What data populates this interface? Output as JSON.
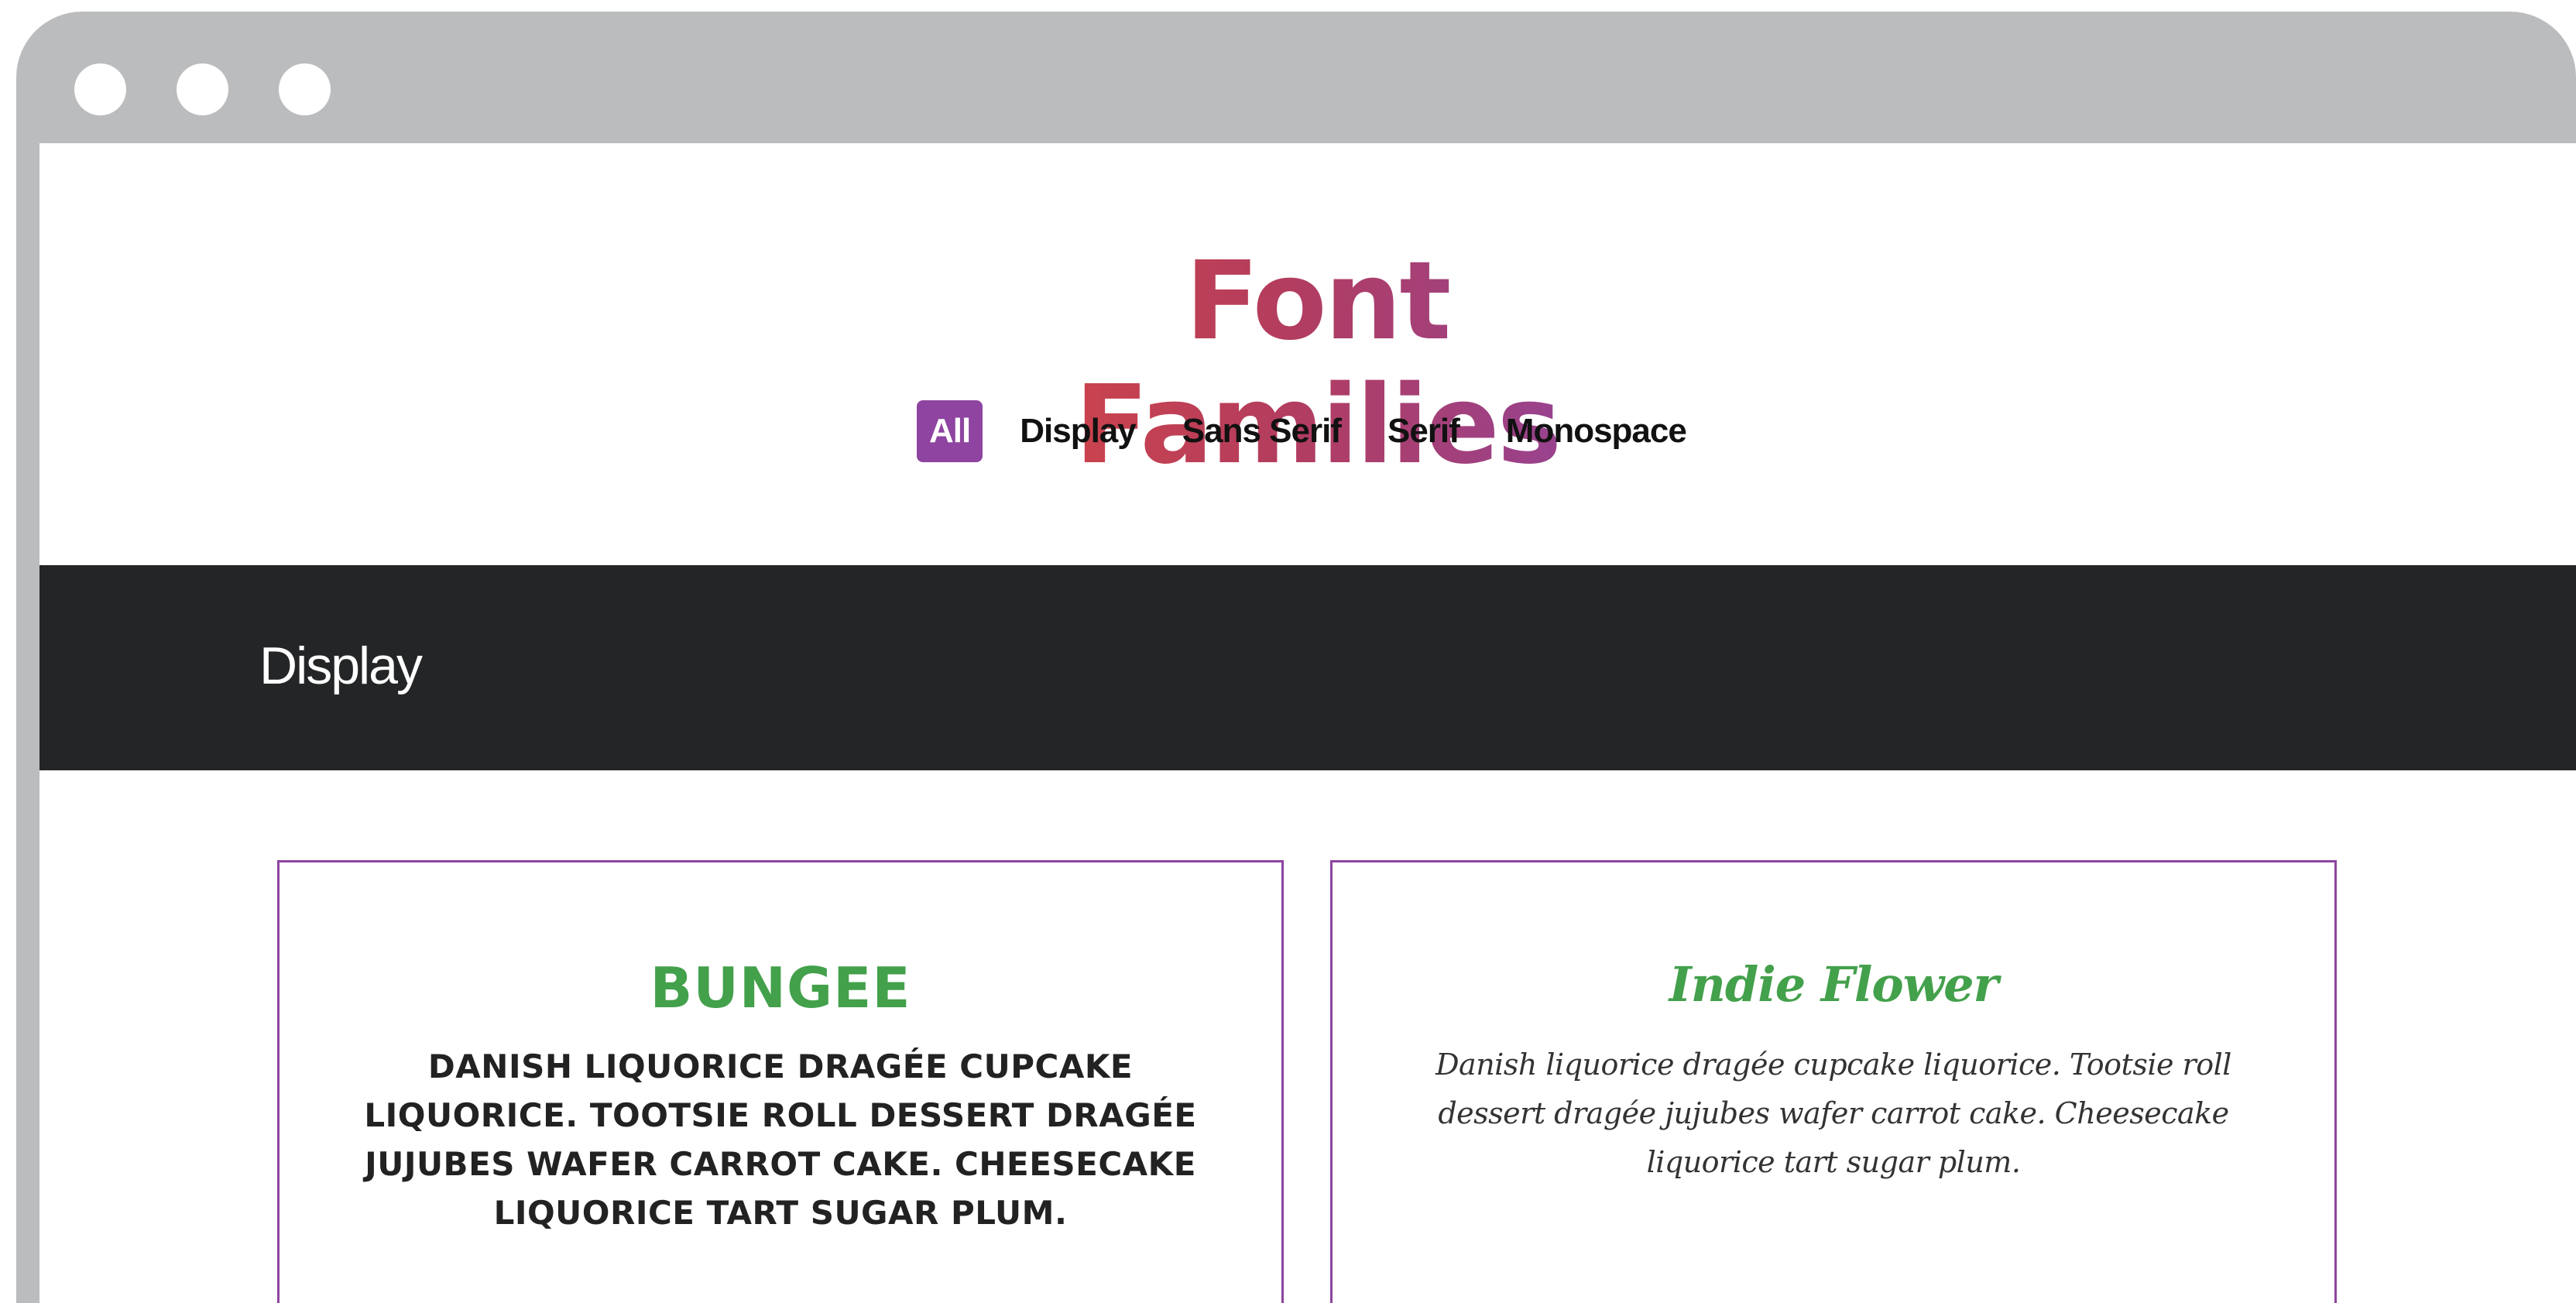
{
  "window": {
    "controls": [
      "close-dot",
      "minimize-dot",
      "zoom-dot"
    ]
  },
  "header": {
    "title": "Font Families"
  },
  "filters": [
    {
      "label": "All",
      "active": true
    },
    {
      "label": "Display",
      "active": false
    },
    {
      "label": "Sans Serif",
      "active": false
    },
    {
      "label": "Serif",
      "active": false
    },
    {
      "label": "Monospace",
      "active": false
    }
  ],
  "section": {
    "title": "Display"
  },
  "cards": [
    {
      "name": "Bungee",
      "sample": "Danish liquorice dragée cupcake liquorice. Tootsie roll dessert dragée jujubes wafer carrot cake. Cheesecake liquorice tart sugar plum."
    },
    {
      "name": "Indie Flower",
      "sample": "Danish liquorice dragée cupcake liquorice. Tootsie roll dessert dragée jujubes wafer carrot cake. Cheesecake liquorice tart sugar plum."
    }
  ],
  "colors": {
    "accent": "#8e44a0",
    "title_gradient_start": "#d64545",
    "title_gradient_end": "#8e44a0",
    "section_bar": "#232526",
    "font_name": "#43a04b",
    "window_chrome": "#bbbcbe"
  }
}
